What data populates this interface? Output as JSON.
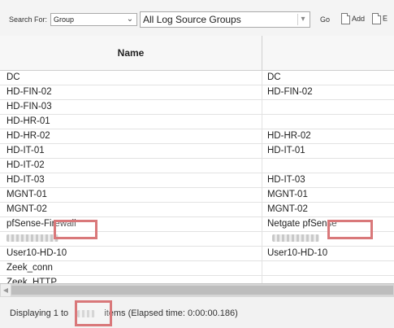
{
  "toolbar": {
    "search_for_label": "Search For:",
    "search_type": {
      "value": "Group"
    },
    "group_filter": {
      "value": "All Log Source Groups"
    },
    "go_label": "Go",
    "add_label": "Add",
    "edit_label": "E"
  },
  "grid": {
    "columns": [
      "Name",
      ""
    ],
    "rows": [
      {
        "name": "DC",
        "col2": "DC"
      },
      {
        "name": "HD-FIN-02",
        "col2": "HD-FIN-02"
      },
      {
        "name": "HD-FIN-03",
        "col2": ""
      },
      {
        "name": "HD-HR-01",
        "col2": ""
      },
      {
        "name": "HD-HR-02",
        "col2": "HD-HR-02"
      },
      {
        "name": "HD-IT-01",
        "col2": "HD-IT-01"
      },
      {
        "name": "HD-IT-02",
        "col2": ""
      },
      {
        "name": "HD-IT-03",
        "col2": "HD-IT-03"
      },
      {
        "name": "MGNT-01",
        "col2": "MGNT-01"
      },
      {
        "name": "MGNT-02",
        "col2": "MGNT-02"
      },
      {
        "name": "pfSense-Firewall",
        "col2": "Netgate pfSense"
      },
      {
        "name": "",
        "col2": ""
      },
      {
        "name": "User10-HD-10",
        "col2": "User10-HD-10"
      },
      {
        "name": "Zeek_conn",
        "col2": ""
      },
      {
        "name": "Zeek_HTTP",
        "col2": ""
      }
    ]
  },
  "footer": {
    "status_prefix": "Displaying 1 to",
    "status_suffix": "items (Elapsed time: 0:00:00.186)"
  },
  "colors": {
    "redaction_outline": "#d9787a",
    "header_bg": "#f7f7f7",
    "scrollbar": "#bdbdbd"
  }
}
